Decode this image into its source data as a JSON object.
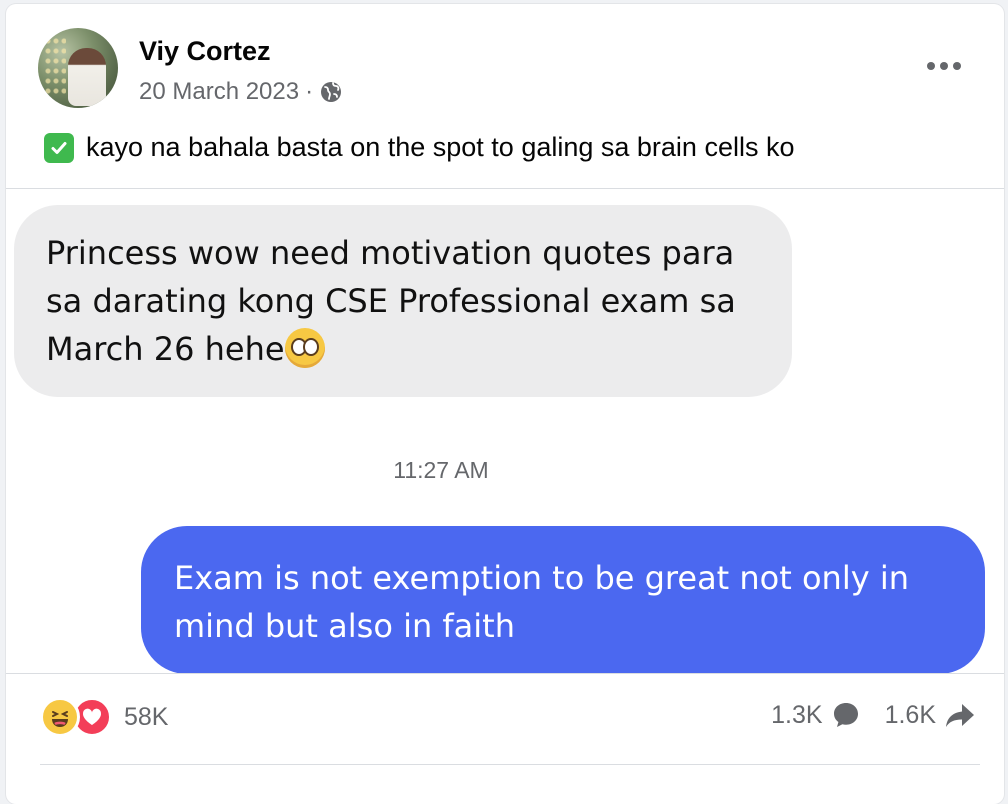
{
  "post": {
    "author": "Viy Cortez",
    "date": "20 March 2023",
    "separator": "·",
    "privacy_icon": "globe-icon",
    "caption": "kayo na bahala basta on the spot to galing sa brain cells ko",
    "caption_icon": "check-mark-icon"
  },
  "chat": {
    "received_message": "Princess wow need motivation quotes para sa darating kong CSE Professional exam sa March 26 hehe",
    "received_emoji": "pleading-face-emoji",
    "timestamp": "11:27 AM",
    "sent_message": "Exam is not exemption to be great not only in mind but also in faith"
  },
  "engagement": {
    "reactions": [
      "haha",
      "love"
    ],
    "reaction_count": "58K",
    "comment_count": "1.3K",
    "share_count": "1.6K"
  },
  "colors": {
    "sent_bubble": "#4b68f0",
    "received_bubble": "#ececed",
    "secondary_text": "#65676b"
  }
}
